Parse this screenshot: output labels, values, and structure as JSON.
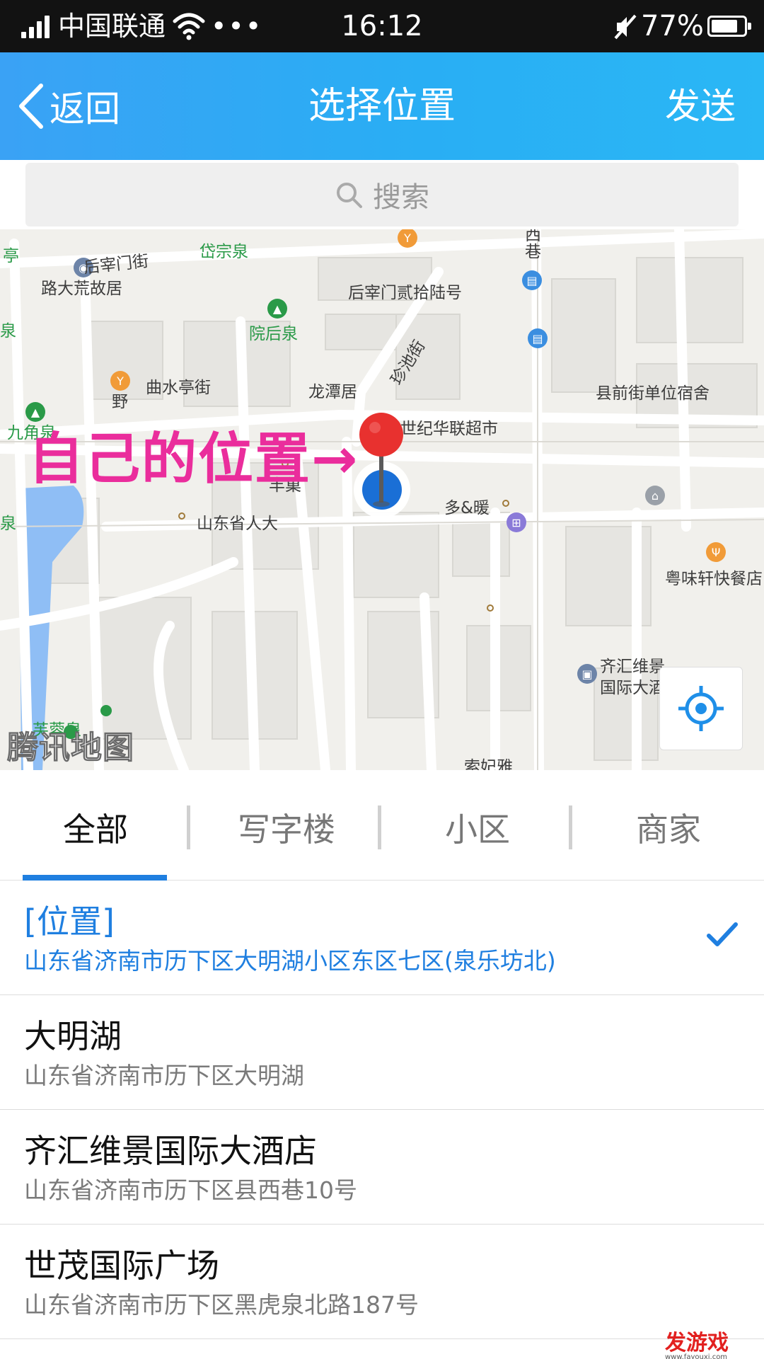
{
  "status_bar": {
    "carrier": "中国联通",
    "dots": "•••",
    "time": "16:12",
    "battery": "77%"
  },
  "nav": {
    "back_label": "返回",
    "title": "选择位置",
    "send_label": "发送"
  },
  "search": {
    "placeholder": "搜索"
  },
  "map": {
    "annotation": "自己的位置→",
    "watermark": "腾讯地图",
    "labels": {
      "hxmj_street": "后宰门街",
      "dzq": "岱宗泉",
      "ting": "亭",
      "quan_left": "泉",
      "xi_xiang": "西巷",
      "hzm_num": "后宰门贰拾陆号",
      "ldhgj": "路大荒故居",
      "zhenchi": "珍池街",
      "yhq": "院后泉",
      "qushuiting": "曲水亭街",
      "ye": "野",
      "ltj": "龙潭居",
      "xqjdw": "县前街单位宿舍",
      "jjq": "九角泉",
      "sjhl": "世纪华联超市",
      "ywxkc": "粤味轩快餐店",
      "fengchao": "丰巢",
      "duoai": "多&暖",
      "sdsrd": "山东省人大",
      "quan_bottom": "泉",
      "qhwj": "齐汇维景",
      "gjdjd": "国际大酒店",
      "furongquan": "芙蓉泉",
      "suofeiya": "索妃雅"
    }
  },
  "tabs": [
    {
      "label": "全部"
    },
    {
      "label": "写字楼"
    },
    {
      "label": "小区"
    },
    {
      "label": "商家"
    }
  ],
  "places": [
    {
      "name": "[位置]",
      "address": "山东省济南市历下区大明湖小区东区七区(泉乐坊北)"
    },
    {
      "name": "大明湖",
      "address": "山东省济南市历下区大明湖"
    },
    {
      "name": "齐汇维景国际大酒店",
      "address": "山东省济南市历下区县西巷10号"
    },
    {
      "name": "世茂国际广场",
      "address": "山东省济南市历下区黑虎泉北路187号"
    }
  ],
  "corner_logo": {
    "text": "发游戏",
    "url": "www.fayouxi.com"
  },
  "colors": {
    "nav_blue": "#2aaef4",
    "accent_blue": "#1f7fe0",
    "annotation_pink": "#ea2d9c",
    "pin_red": "#e8312f"
  }
}
